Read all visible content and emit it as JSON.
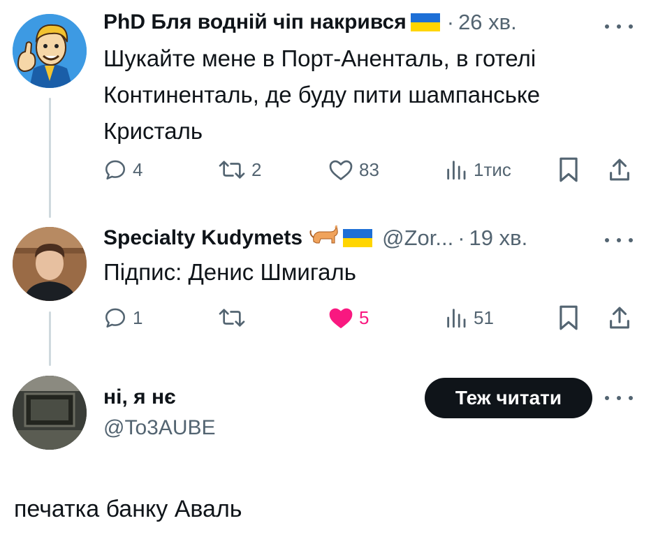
{
  "colors": {
    "text": "#0f1419",
    "muted": "#536471",
    "like_active": "#f91880",
    "thread_line": "#cfd9de",
    "button_bg": "#0f1419",
    "flag_blue": "#1d6fd6",
    "flag_yellow": "#ffd500"
  },
  "tweets": [
    {
      "display_name": "PhD Бля водній чіп накрився",
      "name_emoji": "ukraine-flag",
      "handle": "",
      "dot": "·",
      "time": "26 хв.",
      "text": "Шукайте мене в Порт-Аненталь, в готелі Континенталь, де буду пити шампанське Кристаль",
      "actions": {
        "replies": "4",
        "reposts": "2",
        "likes": "83",
        "views": "1тис",
        "liked": false
      }
    },
    {
      "display_name": "Specialty Kudymets",
      "name_emoji": "cat, ukraine-flag",
      "handle": "@Zor...",
      "dot": "·",
      "time": "19 хв.",
      "text": "Підпис: Денис Шмигаль",
      "actions": {
        "replies": "1",
        "reposts": "",
        "likes": "5",
        "views": "51",
        "liked": true
      }
    }
  ],
  "suggested_user": {
    "display_name": "ні, я нє",
    "handle": "@To3AUBE",
    "follow_label": "Теж читати"
  },
  "footer_text": "печатка банку Аваль",
  "icons": [
    "reply-icon",
    "repost-icon",
    "like-icon",
    "views-icon",
    "bookmark-icon",
    "share-icon",
    "more-icon"
  ]
}
